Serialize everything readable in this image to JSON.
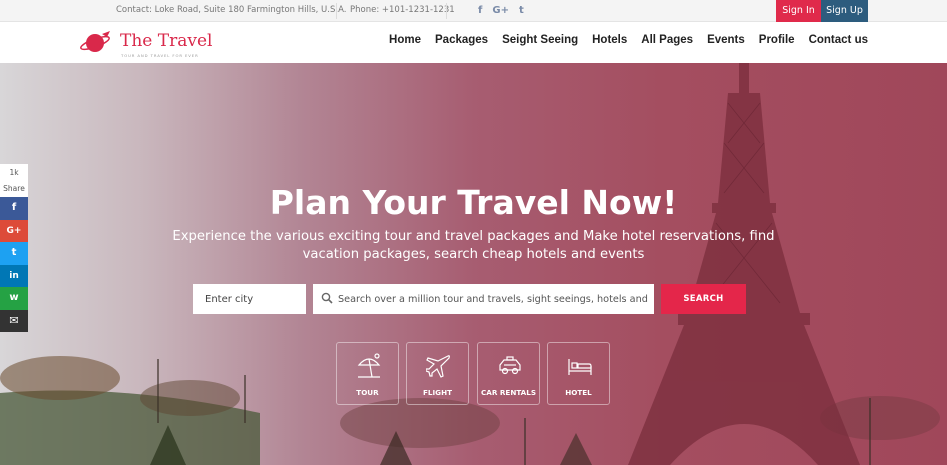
{
  "topbar": {
    "contact": "Contact: Loke Road, Suite 180 Farmington Hills, U.S.A.",
    "phone": "Phone: +101-1231-1231",
    "social": [
      {
        "icon": "facebook-icon",
        "glyph": "f"
      },
      {
        "icon": "google-plus-icon",
        "glyph": "G+"
      },
      {
        "icon": "twitter-icon",
        "glyph": "t"
      }
    ],
    "signin": "Sign In",
    "signup": "Sign Up"
  },
  "brand": {
    "title": "The Travel",
    "tagline": "TOUR AND TRAVEL FOR EVER",
    "color": "#d9284a"
  },
  "nav": [
    "Home",
    "Packages",
    "Seight Seeing",
    "Hotels",
    "All Pages",
    "Events",
    "Profile",
    "Contact us"
  ],
  "hero": {
    "title": "Plan Your Travel Now!",
    "description": "Experience the various exciting tour and travel packages and Make hotel reservations, find vacation packages, search cheap hotels and events",
    "city_placeholder": "Enter city",
    "search_placeholder": "Search over a million tour and travels, sight seeings, hotels and ...",
    "search_button": "SEARCH"
  },
  "categories": [
    {
      "label": "TOUR",
      "icon": "beach-umbrella-icon"
    },
    {
      "label": "FLIGHT",
      "icon": "airplane-icon"
    },
    {
      "label": "CAR RENTALS",
      "icon": "car-icon"
    },
    {
      "label": "HOTEL",
      "icon": "bed-icon"
    }
  ],
  "share": {
    "count": "1k",
    "label": "Share",
    "buttons": [
      {
        "icon": "facebook-icon",
        "glyph": "f",
        "color": "#3b5998"
      },
      {
        "icon": "google-plus-icon",
        "glyph": "G+",
        "color": "#dd4b39"
      },
      {
        "icon": "twitter-icon",
        "glyph": "t",
        "color": "#1da1f2"
      },
      {
        "icon": "linkedin-icon",
        "glyph": "in",
        "color": "#0077b5"
      },
      {
        "icon": "whatsapp-icon",
        "glyph": "w",
        "color": "#25a244"
      },
      {
        "icon": "email-icon",
        "glyph": "✉",
        "color": "#333333"
      }
    ]
  },
  "colors": {
    "accent": "#e4264a",
    "signup": "#2d5c7e"
  }
}
